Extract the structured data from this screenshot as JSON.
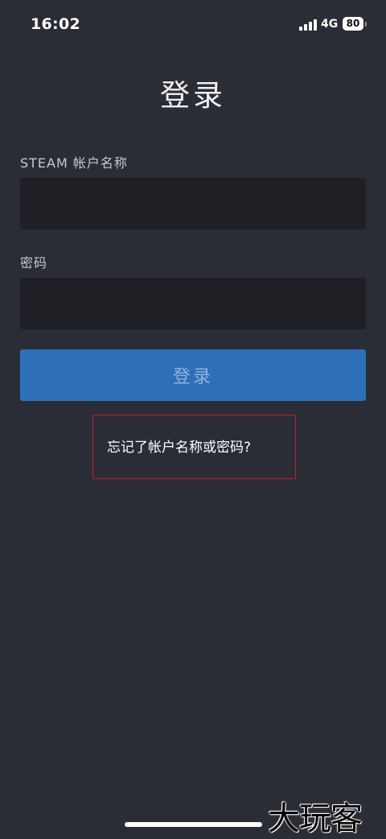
{
  "status_bar": {
    "time": "16:02",
    "network": "4G",
    "battery": "80"
  },
  "page": {
    "title": "登录"
  },
  "form": {
    "username_label": "STEAM 帐户名称",
    "username_value": "",
    "password_label": "密码",
    "password_value": "",
    "login_button": "登录",
    "forgot_link": "忘记了帐户名称或密码?"
  },
  "watermark": "大玩客",
  "colors": {
    "background": "#2a2d36",
    "input_bg": "#1f2026",
    "button": "#2d70b9",
    "highlight": "#c0202c"
  }
}
